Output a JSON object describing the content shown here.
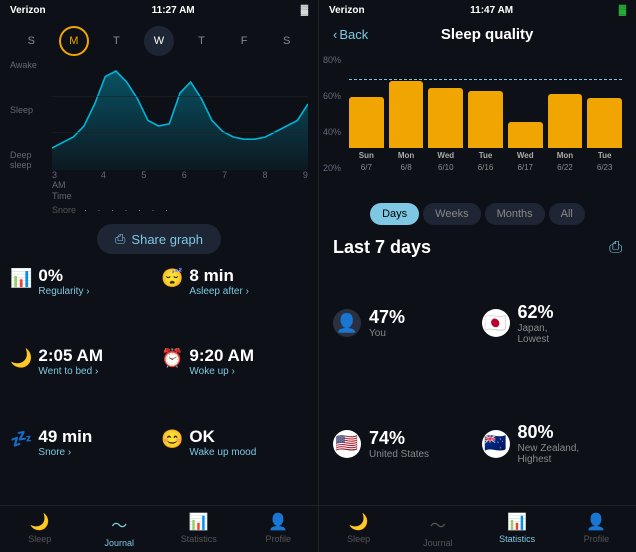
{
  "left": {
    "statusBar": {
      "time": "11:27 AM",
      "carrier": "Verizon"
    },
    "days": [
      {
        "label": "S",
        "state": "dim"
      },
      {
        "label": "M",
        "state": "ring"
      },
      {
        "label": "T",
        "state": "dim"
      },
      {
        "label": "W",
        "state": "active"
      },
      {
        "label": "T",
        "state": "dim"
      },
      {
        "label": "F",
        "state": "dim"
      },
      {
        "label": "S",
        "state": "dim"
      }
    ],
    "chartYLabels": [
      "Awake",
      "Sleep",
      "Deep\nsleep"
    ],
    "chartXLabels": [
      "3\nAM",
      "4",
      "5",
      "6",
      "7",
      "8",
      "9"
    ],
    "timeLabel": "Time",
    "snoreLabel": "Snore",
    "shareGraphLabel": "Share graph",
    "metrics": [
      {
        "icon": "📊",
        "value": "0%",
        "label": "Regularity ›"
      },
      {
        "icon": "😴",
        "value": "8 min",
        "label": "Asleep after ›"
      },
      {
        "icon": "🌙",
        "value": "2:05 AM",
        "label": "Went to bed ›"
      },
      {
        "icon": "⏰",
        "value": "9:20 AM",
        "label": "Woke up ›"
      },
      {
        "icon": "💤",
        "value": "49 min",
        "label": "Snore ›"
      },
      {
        "icon": "😊",
        "value": "OK",
        "label": "Wake up mood"
      }
    ],
    "nav": [
      {
        "icon": "🌙",
        "label": "Sleep",
        "active": false
      },
      {
        "icon": "〜",
        "label": "Journal",
        "active": true
      },
      {
        "icon": "📊",
        "label": "Statistics",
        "active": false
      },
      {
        "icon": "👤",
        "label": "Profile",
        "active": false
      }
    ]
  },
  "right": {
    "statusBar": {
      "time": "11:47 AM",
      "carrier": "Verizon"
    },
    "backLabel": "Back",
    "title": "Sleep quality",
    "chartYLabels": [
      "80%",
      "60%",
      "40%",
      "20%"
    ],
    "bars": [
      {
        "day": "Sun",
        "date": "6/7",
        "heightPct": 55
      },
      {
        "day": "Mon",
        "date": "6/8",
        "heightPct": 70
      },
      {
        "day": "Wed",
        "date": "6/10",
        "heightPct": 65
      },
      {
        "day": "Tue",
        "date": "6/16",
        "heightPct": 62
      },
      {
        "day": "Wed",
        "date": "6/17",
        "heightPct": 28
      },
      {
        "day": "Mon",
        "date": "6/22",
        "heightPct": 58
      },
      {
        "day": "Tue",
        "date": "6/23",
        "heightPct": 54
      }
    ],
    "dashedLinePos": 62,
    "tabs": [
      {
        "label": "Days",
        "active": true
      },
      {
        "label": "Weeks",
        "active": false
      },
      {
        "label": "Months",
        "active": false
      },
      {
        "label": "All",
        "active": false
      }
    ],
    "last7Title": "Last 7 days",
    "stats": [
      {
        "flag": "👤",
        "flagBg": "#2a3040",
        "pct": "47%",
        "label": "You"
      },
      {
        "flag": "🇯🇵",
        "flagBg": "#c0392b",
        "pct": "62%",
        "label": "Japan,\nLowest"
      },
      {
        "flag": "🇺🇸",
        "flagBg": "#1a3a8a",
        "pct": "74%",
        "label": "United States"
      },
      {
        "flag": "🇳🇿",
        "flagBg": "#1a3a8a",
        "pct": "80%",
        "label": "New Zealand,\nHighest"
      }
    ],
    "nav": [
      {
        "icon": "🌙",
        "label": "Sleep",
        "active": false
      },
      {
        "icon": "〜",
        "label": "Journal",
        "active": false
      },
      {
        "icon": "📊",
        "label": "Statistics",
        "active": true
      },
      {
        "icon": "👤",
        "label": "Profile",
        "active": false
      }
    ]
  }
}
